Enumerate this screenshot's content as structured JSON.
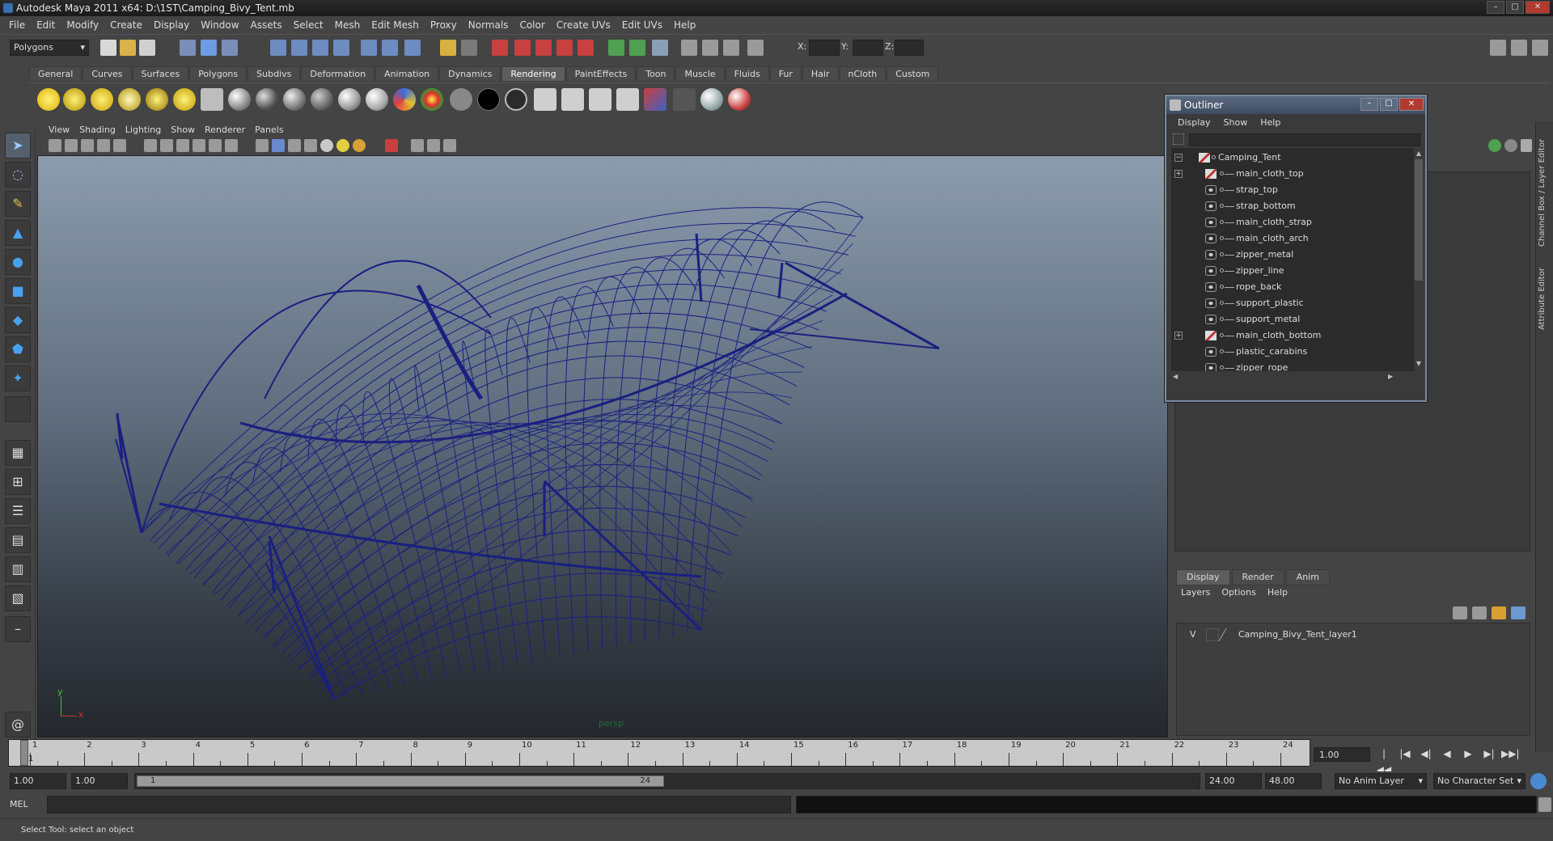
{
  "window": {
    "title": "Autodesk Maya 2011 x64: D:\\1ST\\Camping_Bivy_Tent.mb"
  },
  "menubar": [
    "File",
    "Edit",
    "Modify",
    "Create",
    "Display",
    "Window",
    "Assets",
    "Select",
    "Mesh",
    "Edit Mesh",
    "Proxy",
    "Normals",
    "Color",
    "Create UVs",
    "Edit UVs",
    "Help"
  ],
  "statusline": {
    "mode": "Polygons",
    "x_label": "X:",
    "y_label": "Y:",
    "z_label": "Z:"
  },
  "shelf_tabs": [
    "General",
    "Curves",
    "Surfaces",
    "Polygons",
    "Subdivs",
    "Deformation",
    "Animation",
    "Dynamics",
    "Rendering",
    "PaintEffects",
    "Toon",
    "Muscle",
    "Fluids",
    "Fur",
    "Hair",
    "nCloth",
    "Custom"
  ],
  "shelf_active": "Rendering",
  "viewport": {
    "menu": [
      "View",
      "Shading",
      "Lighting",
      "Show",
      "Renderer",
      "Panels"
    ],
    "camera": "persp",
    "axis_x": "x",
    "axis_y": "y",
    "wire_color": "#1a1f80"
  },
  "outliner": {
    "title": "Outliner",
    "menu": [
      "Display",
      "Show",
      "Help"
    ],
    "items": [
      {
        "label": "Camping_Tent",
        "expand": "−",
        "icon": "transform"
      },
      {
        "label": "main_cloth_top",
        "expand": "+",
        "icon": "transform"
      },
      {
        "label": "strap_top",
        "expand": "",
        "icon": "mesh"
      },
      {
        "label": "strap_bottom",
        "expand": "",
        "icon": "mesh"
      },
      {
        "label": "main_cloth_strap",
        "expand": "",
        "icon": "mesh"
      },
      {
        "label": "main_cloth_arch",
        "expand": "",
        "icon": "mesh"
      },
      {
        "label": "zipper_metal",
        "expand": "",
        "icon": "mesh"
      },
      {
        "label": "zipper_line",
        "expand": "",
        "icon": "mesh"
      },
      {
        "label": "rope_back",
        "expand": "",
        "icon": "mesh"
      },
      {
        "label": "support_plastic",
        "expand": "",
        "icon": "mesh"
      },
      {
        "label": "support_metal",
        "expand": "",
        "icon": "mesh"
      },
      {
        "label": "main_cloth_bottom",
        "expand": "+",
        "icon": "transform"
      },
      {
        "label": "plastic_carabins",
        "expand": "",
        "icon": "mesh"
      },
      {
        "label": "zipper_rope",
        "expand": "",
        "icon": "mesh"
      }
    ]
  },
  "side_tabs": [
    "Channel Box / Layer Editor",
    "Attribute Editor"
  ],
  "layer_editor": {
    "tabs": [
      "Display",
      "Render",
      "Anim"
    ],
    "menu": [
      "Layers",
      "Options",
      "Help"
    ],
    "layer": {
      "visible": "V",
      "name": "Camping_Bivy_Tent_layer1"
    }
  },
  "time_slider": {
    "start_label": "1",
    "ticks": [
      "1",
      "2",
      "3",
      "4",
      "5",
      "6",
      "7",
      "8",
      "9",
      "10",
      "11",
      "12",
      "13",
      "14",
      "15",
      "16",
      "17",
      "18",
      "19",
      "20",
      "21",
      "22",
      "23",
      "24"
    ],
    "current_frame": "1.00"
  },
  "range": {
    "anim_start": "1.00",
    "playback_start": "1.00",
    "range_start": "1",
    "range_end": "24",
    "playback_end": "24.00",
    "anim_end": "48.00",
    "anim_layer": "No Anim Layer",
    "character_set": "No Character Set"
  },
  "command": {
    "mode": "MEL"
  },
  "help_line": "Select Tool: select an object"
}
